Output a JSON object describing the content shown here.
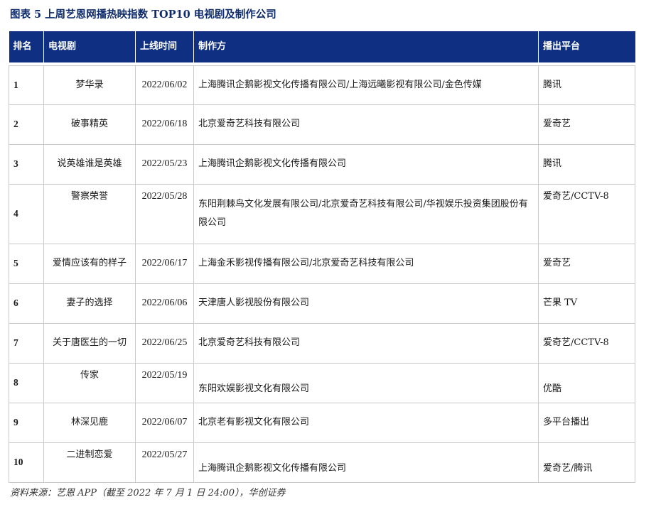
{
  "title": "图表 5 上周艺恩网播热映指数 TOP10 电视剧及制作公司",
  "table": {
    "headers": [
      "排名",
      "电视剧",
      "上线时间",
      "制作方",
      "播出平台"
    ],
    "rows": [
      {
        "rank": "1",
        "drama": "梦华录",
        "date": "2022/06/02",
        "producer": "上海腾讯企鹅影视文化传播有限公司/上海远曦影视有限公司/金色传媒",
        "platform": "腾讯"
      },
      {
        "rank": "2",
        "drama": "破事精英",
        "date": "2022/06/18",
        "producer": "北京爱奇艺科技有限公司",
        "platform": "爱奇艺"
      },
      {
        "rank": "3",
        "drama": "说英雄谁是英雄",
        "date": "2022/05/23",
        "producer": "上海腾讯企鹅影视文化传播有限公司",
        "platform": "腾讯"
      },
      {
        "rank": "4",
        "drama": "警察荣誉",
        "date": "2022/05/28",
        "producer": "东阳荆棘鸟文化发展有限公司/北京爱奇艺科技有限公司/华视娱乐投资集团股份有限公司",
        "platform": "爱奇艺/CCTV-8"
      },
      {
        "rank": "5",
        "drama": "爱情应该有的样子",
        "date": "2022/06/17",
        "producer": "上海金禾影视传播有限公司/北京爱奇艺科技有限公司",
        "platform": "爱奇艺"
      },
      {
        "rank": "6",
        "drama": "妻子的选择",
        "date": "2022/06/06",
        "producer": "天津唐人影视股份有限公司",
        "platform": "芒果 TV"
      },
      {
        "rank": "7",
        "drama": "关于唐医生的一切",
        "date": "2022/06/25",
        "producer": "北京爱奇艺科技有限公司",
        "platform": "爱奇艺/CCTV-8"
      },
      {
        "rank": "8",
        "drama": "传家",
        "date": "2022/05/19",
        "producer": "东阳欢娱影视文化有限公司",
        "platform": "优酷"
      },
      {
        "rank": "9",
        "drama": "林深见鹿",
        "date": "2022/06/07",
        "producer": "北京老有影视文化有限公司",
        "platform": "多平台播出"
      },
      {
        "rank": "10",
        "drama": "二进制恋爱",
        "date": "2022/05/27",
        "producer": "上海腾讯企鹅影视文化传播有限公司",
        "platform": "爱奇艺/腾讯"
      }
    ]
  },
  "source": "资料来源：艺恩 APP（截至 2022 年 7 月 1 日 24:00），华创证券"
}
